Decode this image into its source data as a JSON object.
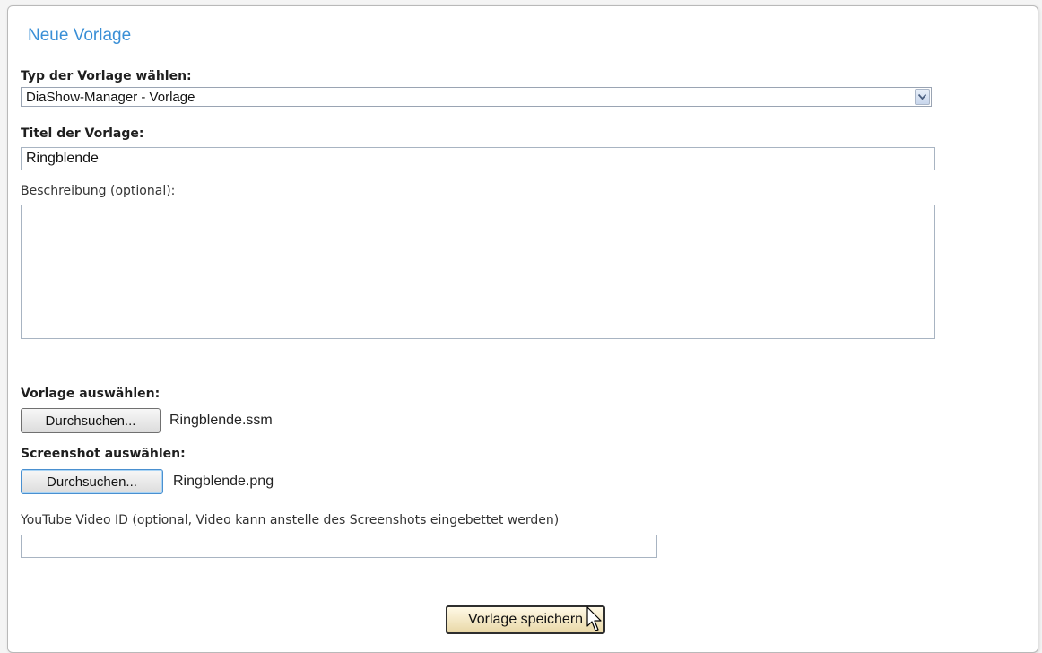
{
  "form": {
    "heading": "Neue Vorlage",
    "type_label": "Typ der Vorlage wählen:",
    "type_selected": "DiaShow-Manager - Vorlage",
    "title_label": "Titel der Vorlage:",
    "title_value": "Ringblende",
    "description_label": "Beschreibung (optional):",
    "description_value": "",
    "template_label": "Vorlage auswählen:",
    "template_browse": "Durchsuchen...",
    "template_file": "Ringblende.ssm",
    "screenshot_label": "Screenshot auswählen:",
    "screenshot_browse": "Durchsuchen...",
    "screenshot_file": "Ringblende.png",
    "youtube_label": "YouTube Video ID (optional, Video kann anstelle des Screenshots eingebettet werden)",
    "youtube_value": "",
    "save_label": "Vorlage speichern"
  },
  "icons": {
    "select_arrow": "chevron-down-icon",
    "resize_grip": "resize-grip-icon",
    "cursor": "mouse-pointer-icon"
  },
  "colors": {
    "heading": "#3a8fd6",
    "save_button": "#e9d8a7"
  }
}
